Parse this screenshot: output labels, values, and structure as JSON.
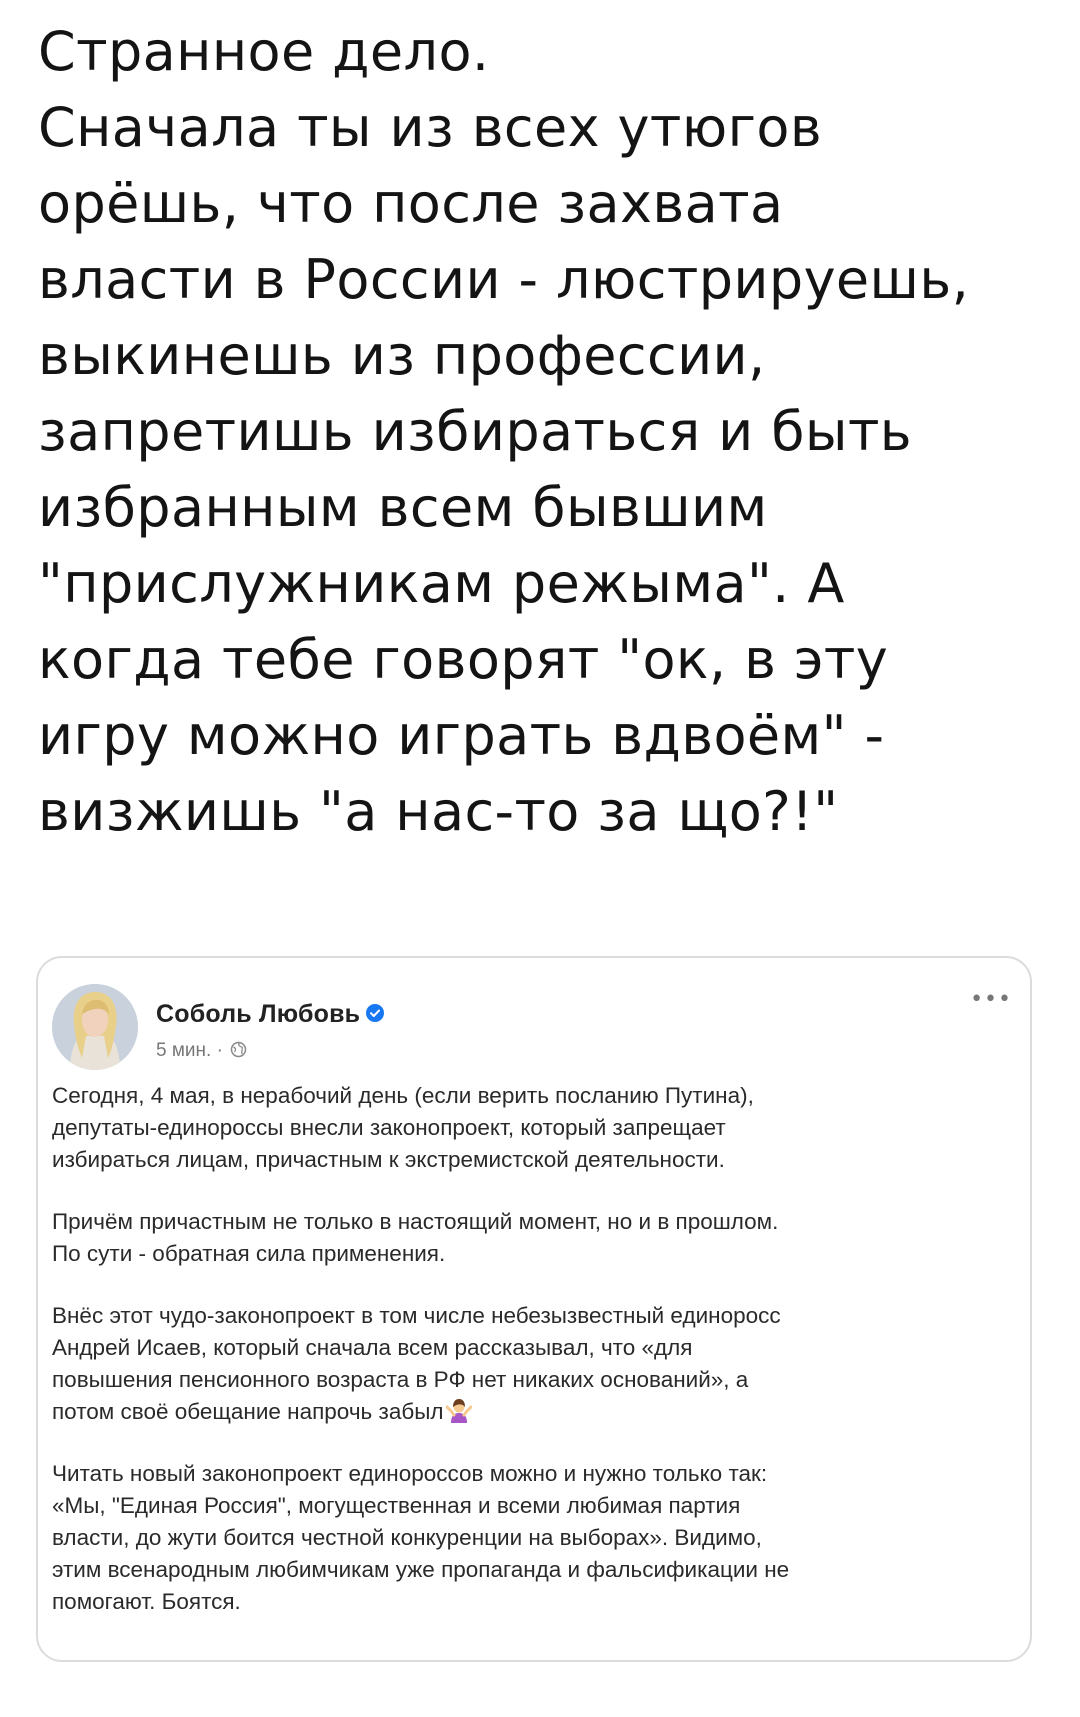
{
  "tweet": {
    "lines": [
      "Странное дело.",
      "Сначала ты из всех утюгов",
      "орёшь, что после захвата",
      "власти в России - люстрируешь,",
      "выкинешь из профессии,",
      "запретишь избираться и быть",
      "избранным всем бывшим",
      "\"прислужникам режыма\". А",
      "когда тебе говорят \"ок, в эту",
      "игру можно играть вдвоём\" -",
      "визжишь \"а нас-то за що?!\""
    ]
  },
  "embed": {
    "author": "Соболь Любовь",
    "time": "5 мин. ·",
    "icons": {
      "verified": "verified-badge-icon",
      "audience": "globe-icon",
      "more": "more-options-icon",
      "emoji": "shrug-woman-emoji"
    },
    "colors": {
      "verified": "#1877f2"
    },
    "paragraphs": [
      [
        "Сегодня, 4 мая, в нерабочий день (если верить посланию Путина),",
        "депутаты-единороссы внесли законопроект, который запрещает",
        "избираться лицам, причастным к экстремистской деятельности."
      ],
      [
        "Причём причастным не только в настоящий момент, но и в прошлом.",
        "По сути - обратная сила применения."
      ],
      [
        "Внёс этот чудо-законопроект в том числе небезызвестный единоросс",
        "Андрей Исаев, который сначала всем рассказывал, что «для",
        "повышения пенсионного возраста в РФ нет никаких оснований», а",
        "потом своё обещание напрочь забыл"
      ],
      [
        "Читать новый законопроект единороссов можно и нужно только так:",
        "«Мы, \"Единая Россия\", могущественная и всеми любимая партия",
        "власти, до жути боится честной конкуренции на выборах». Видимо,",
        "этим всенародным любимчикам уже пропаганда и фальсификации не",
        "помогают. Боятся."
      ]
    ]
  }
}
